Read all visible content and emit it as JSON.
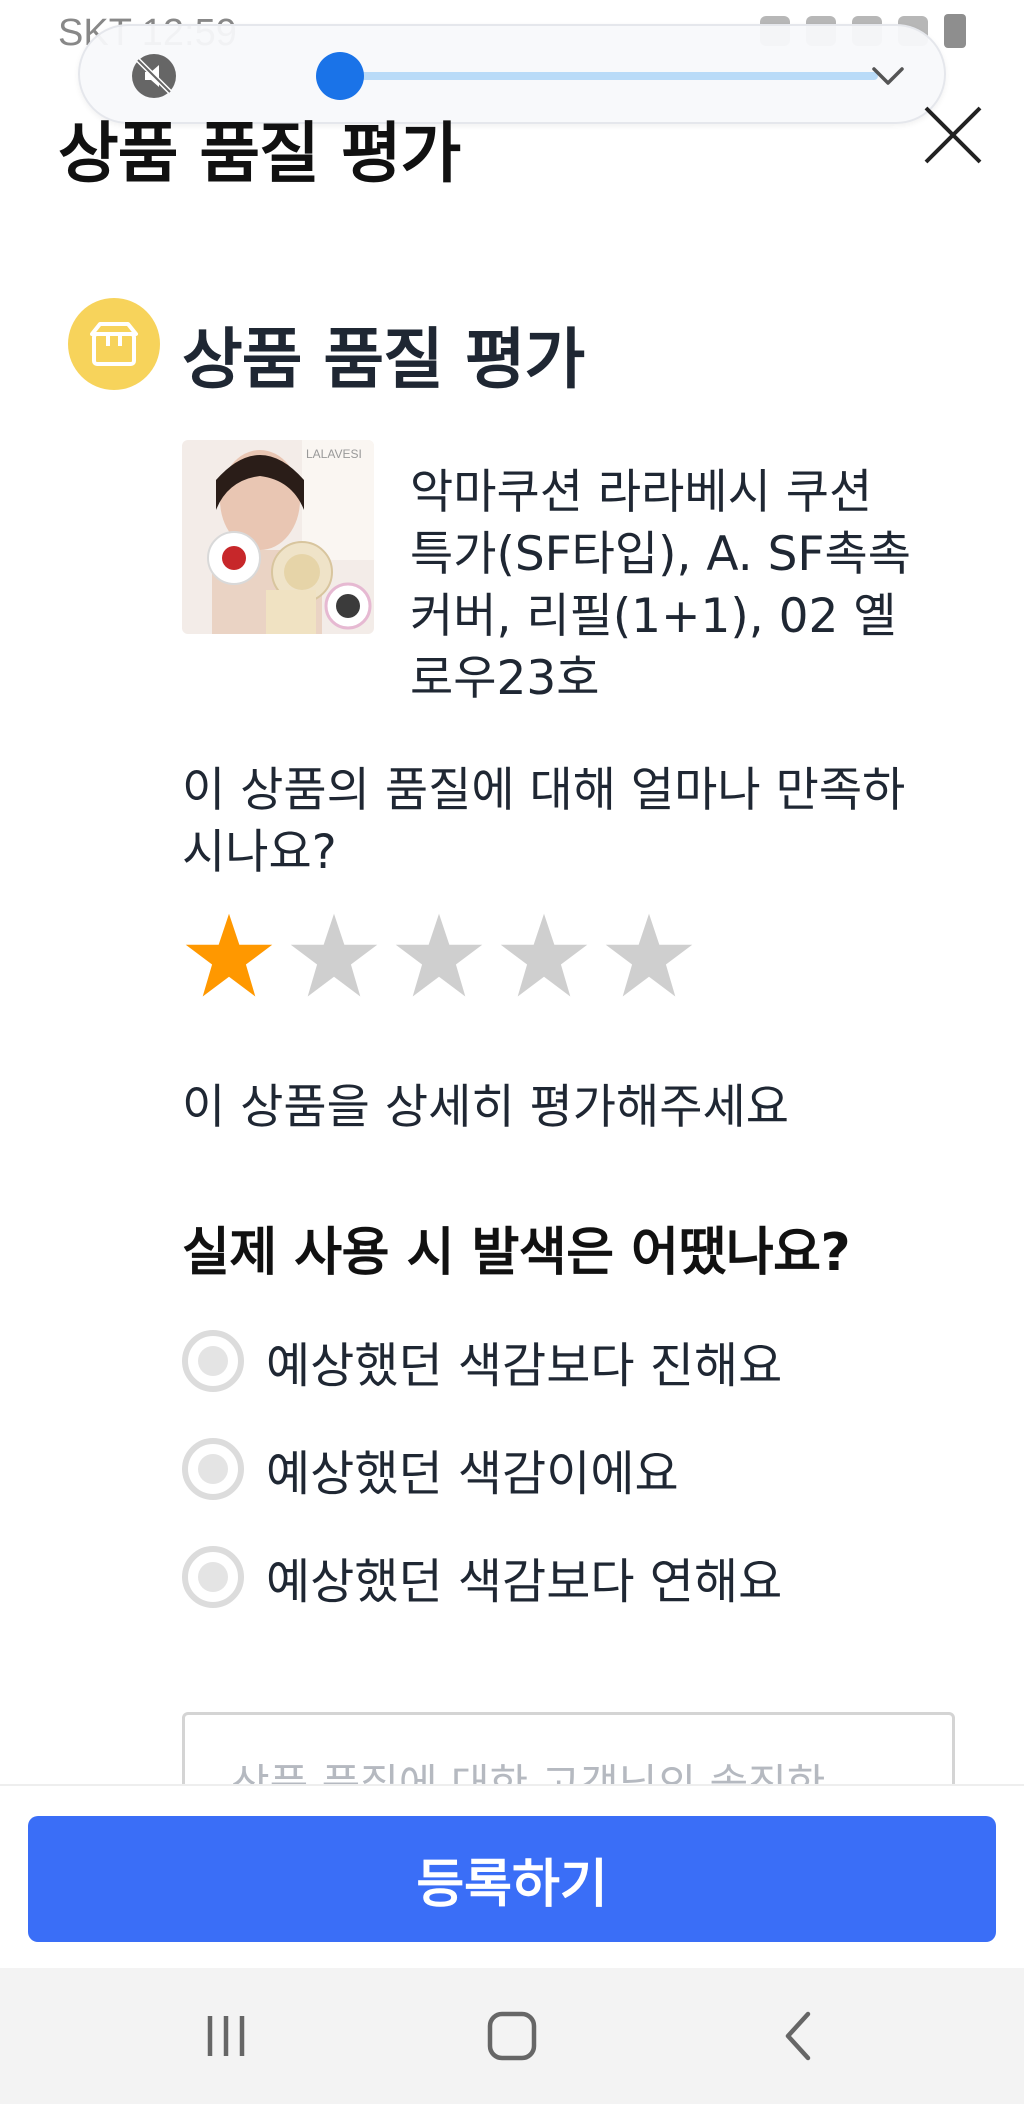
{
  "status_bar": {
    "carrier_time": "SKT 12:59"
  },
  "volume_panel": {
    "level_fraction": 0.04
  },
  "header": {
    "title": "상품 품질 평가"
  },
  "section": {
    "title": "상품 품질 평가",
    "icon": "box-icon",
    "icon_color": "#f7d35b"
  },
  "product": {
    "name": "악마쿠션 라라베시 쿠션 특가(SF타입), A. SF촉촉커버, 리필(1+1), 02 옐로우23호",
    "image_brand_text": "LALAVESI"
  },
  "rating": {
    "question": "이 상품의 품질에 대해 얼마나 만족하시나요?",
    "value": 1,
    "max": 5,
    "active_color": "#ff9800",
    "inactive_color": "#cfcfcf"
  },
  "detail": {
    "prompt": "이 상품을 상세히 평가해주세요"
  },
  "color_question": {
    "title": "실제 사용 시 발색은 어땠나요?",
    "options": [
      {
        "label": "예상했던 색감보다 진해요"
      },
      {
        "label": "예상했던 색감이에요"
      },
      {
        "label": "예상했던 색감보다 연해요"
      }
    ]
  },
  "review": {
    "placeholder": "상품 품질에 대한 고객님의 솔직한"
  },
  "submit": {
    "label": "등록하기",
    "color": "#3a6ef7"
  },
  "nav": {
    "icons": [
      "recent-apps-icon",
      "home-icon",
      "back-icon"
    ]
  }
}
